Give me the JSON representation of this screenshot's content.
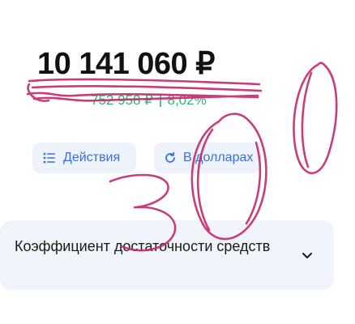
{
  "balance": {
    "amount": "10 141 060 ₽",
    "change_value": "752 958 ₽",
    "change_percent": "8,02%"
  },
  "actions": {
    "actions_label": "Действия",
    "currency_label": "В долларах"
  },
  "coefficient": {
    "title": "Коэффициент достаточности средств"
  },
  "colors": {
    "accent": "#3a6fd8",
    "positive": "#30b56e",
    "scribble": "#c3296b"
  },
  "icons": {
    "actions": "list-icon",
    "currency": "refresh-icon",
    "expand": "chevron-down-icon"
  },
  "handwriting": "300"
}
